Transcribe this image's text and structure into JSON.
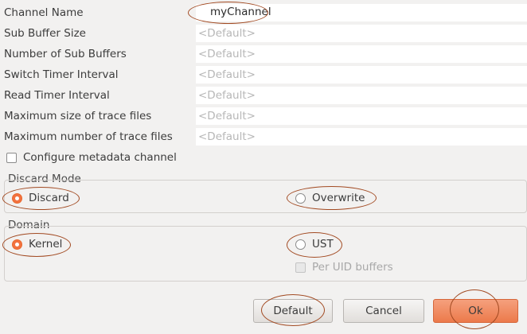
{
  "fields": [
    {
      "label": "Channel Name",
      "value": "myChannel",
      "placeholder": ""
    },
    {
      "label": "Sub Buffer Size",
      "value": "",
      "placeholder": "<Default>"
    },
    {
      "label": "Number of Sub Buffers",
      "value": "",
      "placeholder": "<Default>"
    },
    {
      "label": "Switch Timer Interval",
      "value": "",
      "placeholder": "<Default>"
    },
    {
      "label": "Read Timer Interval",
      "value": "",
      "placeholder": "<Default>"
    },
    {
      "label": "Maximum size of trace files",
      "value": "",
      "placeholder": "<Default>"
    },
    {
      "label": "Maximum number of trace files",
      "value": "",
      "placeholder": "<Default>"
    }
  ],
  "metadata_checkbox": {
    "label": "Configure metadata channel",
    "checked": false
  },
  "discard_mode": {
    "title": "Discard Mode",
    "options": [
      {
        "label": "Discard",
        "selected": true
      },
      {
        "label": "Overwrite",
        "selected": false
      }
    ]
  },
  "domain": {
    "title": "Domain",
    "options": [
      {
        "label": "Kernel",
        "selected": true
      },
      {
        "label": "UST",
        "selected": false
      }
    ],
    "per_uid": {
      "label": "Per UID buffers",
      "checked": false,
      "enabled": false
    }
  },
  "buttons": {
    "default": "Default",
    "cancel": "Cancel",
    "ok": "Ok"
  },
  "colors": {
    "accent": "#f27240",
    "annotation": "#a24a22"
  }
}
